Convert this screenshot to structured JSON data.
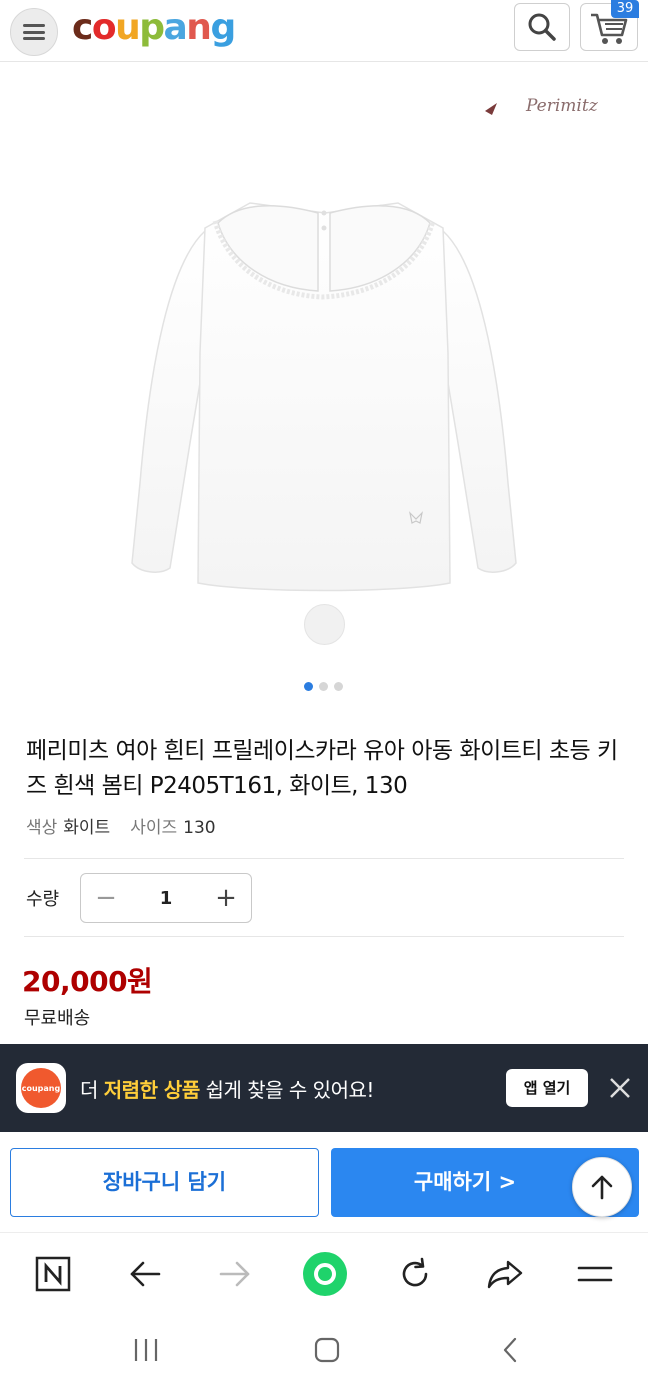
{
  "header": {
    "logo_letters": [
      {
        "ch": "c",
        "color": "#6b2b1a"
      },
      {
        "ch": "o",
        "color": "#e32b2b"
      },
      {
        "ch": "u",
        "color": "#f1a623"
      },
      {
        "ch": "p",
        "color": "#8dbb3a"
      },
      {
        "ch": "a",
        "color": "#4aa6e0"
      },
      {
        "ch": "n",
        "color": "#e0584e"
      },
      {
        "ch": "g",
        "color": "#3a9fe0"
      }
    ],
    "cart_count": "39"
  },
  "product": {
    "brand": "Perimitz",
    "title": "페리미츠 여아 흰티 프릴레이스카라 유아 아동 화이트티 초등 키즈 흰색 봄티 P2405T161, 화이트, 130",
    "color_label": "색상",
    "color_value": "화이트",
    "size_label": "사이즈",
    "size_value": "130",
    "qty_label": "수량",
    "qty_value": "1",
    "price": "20,000원",
    "shipping": "무료배송",
    "image_count": 3,
    "active_image": 0
  },
  "app_banner": {
    "icon_text": "coupang",
    "text_before": "더 ",
    "text_highlight": "저렴한 상품",
    "text_after": " 쉽게 찾을 수 있어요!",
    "open_button": "앱 열기"
  },
  "actions": {
    "add_to_cart": "장바구니 담기",
    "buy_now": "구매하기 >"
  },
  "colors": {
    "accent": "#2b87f0",
    "price": "#ae0000",
    "banner_bg": "#232a36",
    "highlight": "#ffce3a"
  }
}
